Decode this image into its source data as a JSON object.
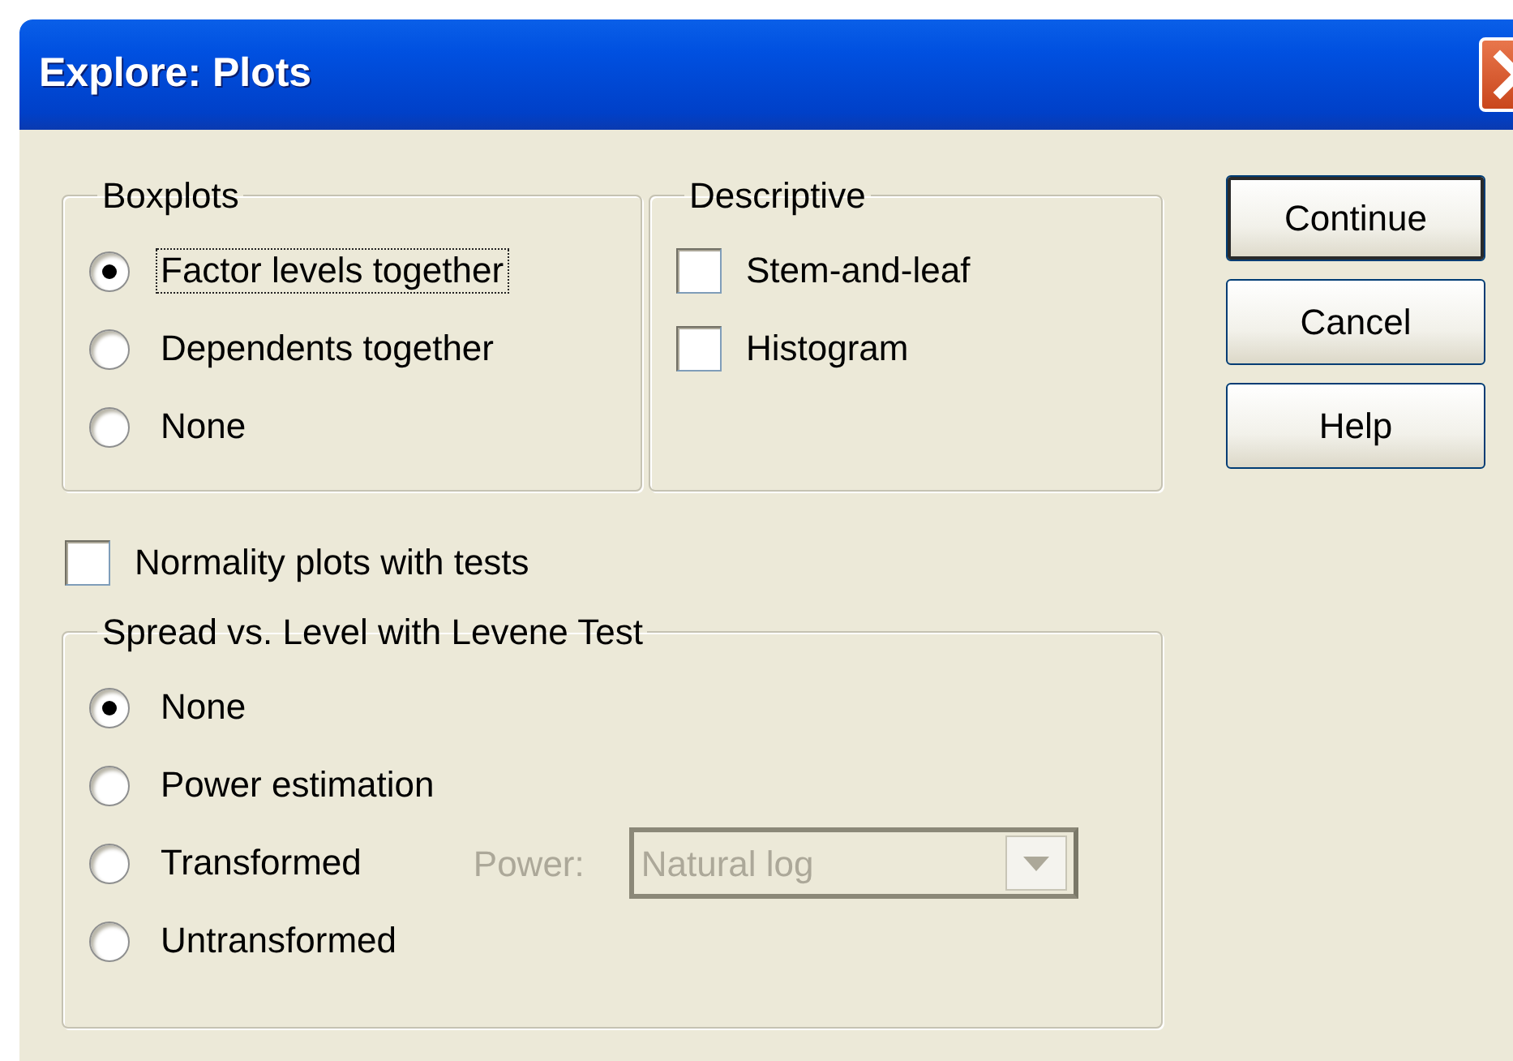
{
  "window": {
    "title": "Explore: Plots"
  },
  "boxplots": {
    "title": "Boxplots",
    "options": [
      {
        "label": "Factor levels together",
        "selected": true,
        "focused": true
      },
      {
        "label": "Dependents together",
        "selected": false,
        "focused": false
      },
      {
        "label": "None",
        "selected": false,
        "focused": false
      }
    ]
  },
  "descriptive": {
    "title": "Descriptive",
    "options": [
      {
        "label": "Stem-and-leaf",
        "checked": false
      },
      {
        "label": "Histogram",
        "checked": false
      }
    ]
  },
  "buttons": [
    {
      "label": "Continue",
      "default": true
    },
    {
      "label": "Cancel",
      "default": false
    },
    {
      "label": "Help",
      "default": false
    }
  ],
  "normality": {
    "label": "Normality plots with tests",
    "checked": false
  },
  "spread": {
    "title": "Spread vs. Level with Levene Test",
    "options": [
      {
        "label": "None",
        "selected": true
      },
      {
        "label": "Power estimation",
        "selected": false
      },
      {
        "label": "Transformed",
        "selected": false,
        "power": {
          "label": "Power:",
          "value": "Natural log",
          "disabled": true
        }
      },
      {
        "label": "Untransformed",
        "selected": false
      }
    ]
  }
}
